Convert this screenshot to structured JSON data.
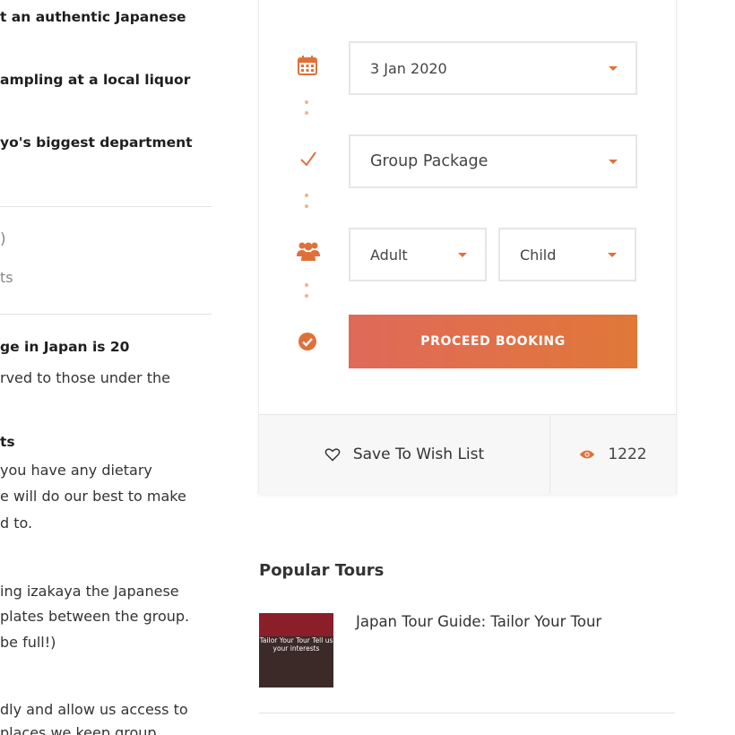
{
  "left_column": {
    "bullets": [
      "t an authentic Japanese",
      "ampling at a local liquor",
      "yo's biggest department"
    ],
    "rating_partial": ")",
    "reviews_partial": "ts",
    "age_heading": "ge in Japan is 20",
    "age_text": "rved to those under the",
    "diet_heading": "ts",
    "diet_lines": [
      "you have any dietary",
      "e will do our best to make",
      "d to."
    ],
    "izakaya_lines": [
      "ing izakaya the Japanese",
      "plates between the group.",
      "be full!)"
    ],
    "access_lines": [
      "dly and allow us access to",
      "places we keep group"
    ]
  },
  "booking": {
    "date_value": "3 Jan 2020",
    "package_value": "Group Package",
    "adult_label": "Adult",
    "child_label": "Child",
    "proceed_label": "PROCEED BOOKING",
    "wish_label": "Save To Wish List",
    "views_count": "1222",
    "accent_color": "#e0703a"
  },
  "popular": {
    "title": "Popular Tours",
    "tours": [
      {
        "title": "Japan Tour Guide: Tailor Your Tour",
        "thumb_text": "Tailor Your Tour Tell us your interests"
      }
    ]
  },
  "icons": [
    "calendar-icon",
    "check-icon",
    "group-icon",
    "check-circle-icon",
    "heart-icon",
    "eye-icon"
  ]
}
